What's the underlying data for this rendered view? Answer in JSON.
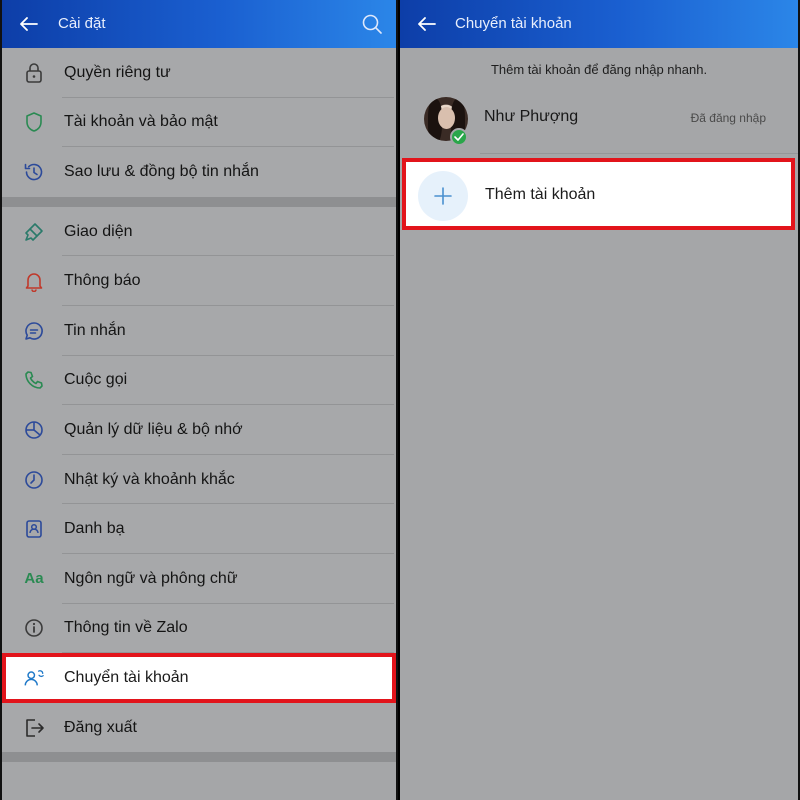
{
  "left": {
    "header": {
      "title": "Cài đặt"
    },
    "groups": [
      [
        {
          "label": "Quyền riêng tư",
          "icon": "lock-icon"
        },
        {
          "label": "Tài khoản và bảo mật",
          "icon": "shield-icon"
        },
        {
          "label": "Sao lưu & đồng bộ tin nhắn",
          "icon": "history-icon"
        }
      ],
      [
        {
          "label": "Giao diện",
          "icon": "paintbrush-icon"
        },
        {
          "label": "Thông báo",
          "icon": "bell-icon"
        },
        {
          "label": "Tin nhắn",
          "icon": "chat-icon"
        },
        {
          "label": "Cuộc gọi",
          "icon": "phone-icon"
        },
        {
          "label": "Quản lý dữ liệu & bộ nhớ",
          "icon": "pie-chart-icon"
        },
        {
          "label": "Nhật ký và khoảnh khắc",
          "icon": "clock-icon"
        },
        {
          "label": "Danh bạ",
          "icon": "contacts-icon"
        },
        {
          "label": "Ngôn ngữ và phông chữ",
          "icon": "font-icon",
          "glyph": "Aa"
        },
        {
          "label": "Thông tin về Zalo",
          "icon": "info-icon"
        },
        {
          "label": "Chuyển tài khoản",
          "icon": "switch-account-icon",
          "highlighted": true
        },
        {
          "label": "Đăng xuất",
          "icon": "logout-icon"
        }
      ]
    ]
  },
  "right": {
    "header": {
      "title": "Chuyển tài khoản"
    },
    "hint": "Thêm tài khoản để đăng nhập nhanh.",
    "account": {
      "name": "Như Phượng",
      "status": "Đã đăng nhập"
    },
    "add_label": "Thêm tài khoản"
  },
  "colors": {
    "header_start": "#0d3ea8",
    "header_end": "#2b86e8",
    "highlight_border": "#e2141b",
    "check_green": "#2aa64a"
  }
}
